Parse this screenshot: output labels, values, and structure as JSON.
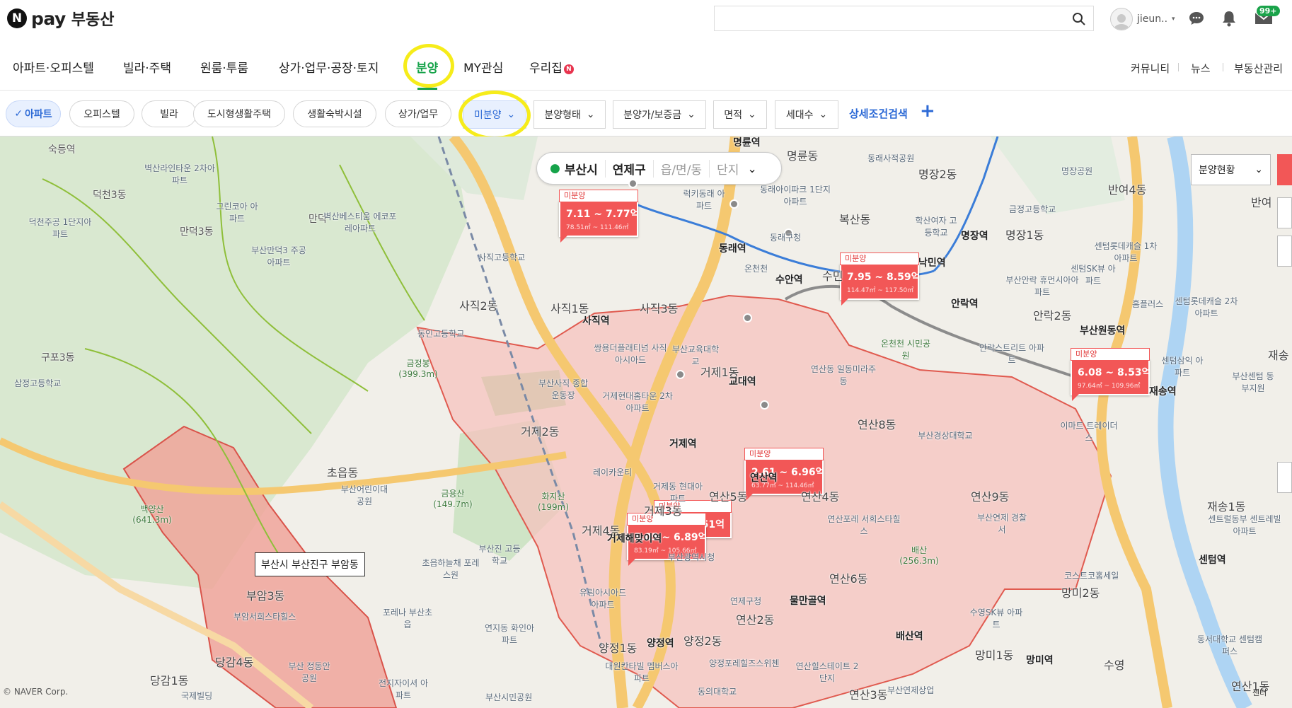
{
  "header": {
    "logo_mark": "N",
    "logo_pay": "pay",
    "service_name": "부동산",
    "search_value": "",
    "user_name": "jieun..",
    "mail_badge": "99+"
  },
  "nav": {
    "items": [
      {
        "label": "아파트·오피스텔",
        "active": false
      },
      {
        "label": "빌라·주택",
        "active": false
      },
      {
        "label": "원룸·투룸",
        "active": false
      },
      {
        "label": "상가·업무·공장·토지",
        "active": false
      },
      {
        "label": "분양",
        "active": true
      },
      {
        "label": "MY관심",
        "active": false
      },
      {
        "label": "우리집",
        "active": false
      }
    ],
    "new_badge": "N",
    "right_links": [
      "커뮤니티",
      "뉴스",
      "부동산관리"
    ]
  },
  "filters": {
    "chips": [
      "아파트",
      "오피스텔",
      "빌라",
      "도시형생활주택",
      "생활숙박시설",
      "상가/업무"
    ],
    "dropdowns": [
      "미분양",
      "분양형태",
      "분양가/보증금",
      "면적",
      "세대수"
    ],
    "detail_search": "상세조건검색",
    "plus": "+"
  },
  "map": {
    "region": {
      "city": "부산시",
      "district": "연제구",
      "town": "읍/면/동",
      "complex": "단지"
    },
    "status_dropdown": "분양현황",
    "address_tooltip": "부산시 부산진구 부암동",
    "copyright": "© NAVER Corp.",
    "scale_label": "센터",
    "markers": [
      {
        "tag": "미분양",
        "price": "7.11 ~ 7.77억",
        "area": "78.51㎡ ~ 111.46㎡"
      },
      {
        "tag": "미분양",
        "price": "7.95 ~ 8.59억",
        "area": "114.47㎡ ~ 117.50㎡"
      },
      {
        "tag": "미분양",
        "price": "6.08 ~ 8.53억",
        "area": "97.64㎡ ~ 109.96㎡"
      },
      {
        "tag": "미분양",
        "price": "2.61 ~ 6.96억",
        "area": "63.77㎡ ~ 114.46㎡"
      },
      {
        "tag": "미분양",
        "price": "51억",
        "area": ""
      },
      {
        "tag": "미분양",
        "price": "5.05 ~ 6.89억",
        "area": "83.19㎡ ~ 105.66㎡"
      }
    ],
    "place_labels": [
      "숙등역",
      "벽산라인타운 2차아파트",
      "덕천3동",
      "그린코아 아파트",
      "덕천주공 1단지아파트",
      "만덕3동",
      "만덕",
      "벽산베스티움 에코포레아파트",
      "부산만덕3 주공아파트",
      "사직고등학교",
      "구포3동",
      "삼정고등학교",
      "동인고등학교",
      "사직2동",
      "사직1동",
      "사직역",
      "사직3동",
      "쌍용더플래티넘 사직아시아드",
      "부산교육대학교",
      "부산사직 종합운동장",
      "거제현대홈타운 2차아파트",
      "거제1동",
      "교대역",
      "거제2동",
      "금정봉 (399.3m)",
      "금용산 (149.7m)",
      "화지산 (199m)",
      "초읍동",
      "부산어린이대공원",
      "백양산 (641.3m)",
      "레이카운티",
      "거제역",
      "거제동 현대아파트",
      "거제3동",
      "연산5동",
      "연산역",
      "거제4동",
      "거제해맞이역",
      "연산4동",
      "부산광역시청",
      "초읍하늘채 포레스원",
      "부산진 고등학교",
      "포레나 부산초읍",
      "부암3동",
      "부암서희스타힐스",
      "당감4동",
      "연지동 화인아파트",
      "유림아시아드 아파트",
      "양정1동",
      "양정역",
      "대원칸타빌 멤버스아파트",
      "양정2동",
      "연제구청",
      "연산2동",
      "물만골역",
      "양정포레힐즈스위첸",
      "당감1동",
      "국제빌딩",
      "부산 정동안공원",
      "전지자이셔 아파트",
      "부산시민공원",
      "동의대학교",
      "연산힐스테이트 2단지",
      "연산3동",
      "부산연제상업",
      "명륜역",
      "명륜동",
      "동래사적공원",
      "명장2동",
      "명장공원",
      "반여4동",
      "금정고등학교",
      "반여",
      "럭키동래 아파트",
      "동래아이파크 1단지아파트",
      "복산동",
      "동래역",
      "동래구청",
      "학산여자 고등학교",
      "명장역",
      "명장1동",
      "센텀롯데캐슬 1차아파트",
      "센텀SK뷰 아파트",
      "수안역",
      "온천천",
      "수민",
      "낙민역",
      "부산안락 휴먼시아아파트",
      "홈플러스",
      "센텀롯데캐슬 2차아파트",
      "안락역",
      "안락2동",
      "부산원동역",
      "온천천 시민공원",
      "연산동 일동미라주동",
      "안락스트리트 아파트",
      "센텀삼익 아파트",
      "재송역",
      "부산센텀 동부지원",
      "재송",
      "연산8동",
      "부산경상대학교",
      "연산9동",
      "이마트 트레이더스",
      "부산연제 경찰서",
      "연산포레 서희스타힐스",
      "배산 (256.3m)",
      "재송1동",
      "센트럴동부 센트레빌아파트",
      "센텀역",
      "코스트코홈세일",
      "망미2동",
      "연산6동",
      "수영SK뷰 아파트",
      "배산역",
      "망미1동",
      "망미역",
      "수영",
      "동서대학교 센텀캠퍼스",
      "연산1동"
    ]
  },
  "colors": {
    "accent_green": "#16a34a",
    "accent_blue": "#2d6ad6",
    "marker_red": "#f25757",
    "highlight_yellow": "#f6ec1a",
    "region_fill": "#f6c3bd"
  }
}
